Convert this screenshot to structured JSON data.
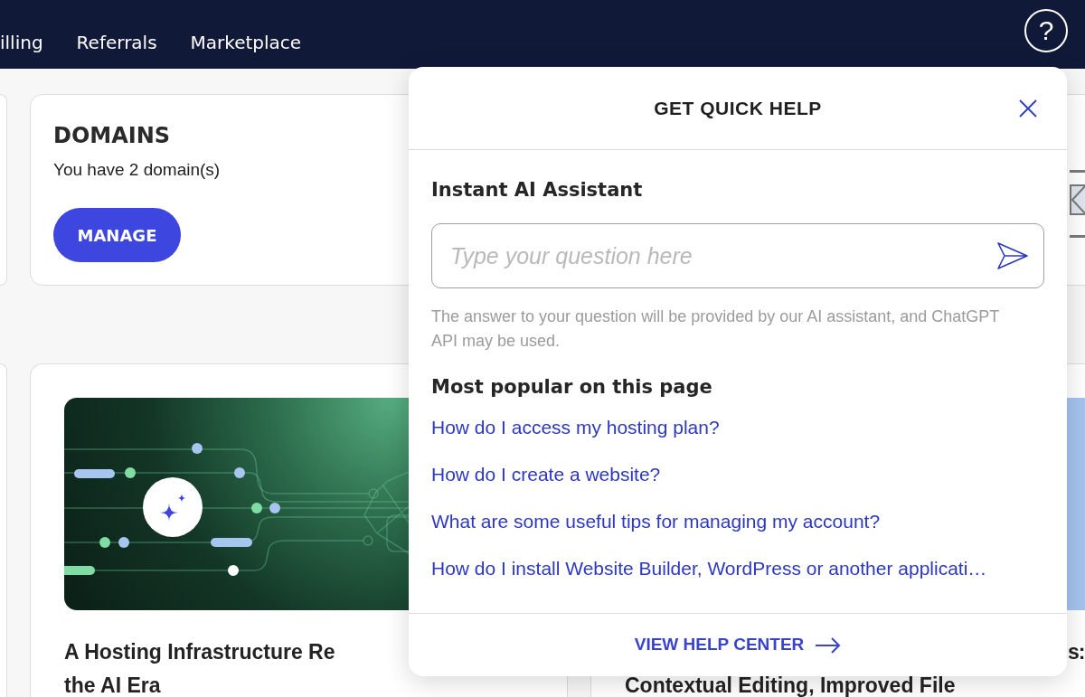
{
  "top_nav": {
    "items": [
      "illing",
      "Referrals",
      "Marketplace"
    ],
    "help_button": "?"
  },
  "domains_card": {
    "title": "DOMAINS",
    "text": "You have 2 domain(s)",
    "button": "MANAGE"
  },
  "articles": [
    {
      "title_lines": [
        "A Hosting Infrastructure Re",
        "the AI Era"
      ]
    },
    {
      "title_lines": [
        "s:",
        "Contextual Editing, Improved File"
      ]
    }
  ],
  "quick_help": {
    "title": "GET QUICK HELP",
    "assistant_heading": "Instant AI Assistant",
    "question_field": {
      "placeholder": "Type your question here"
    },
    "disclaimer": "The answer to your question will be provided by our AI assistant, and ChatGPT API may be used.",
    "popular_heading": "Most popular on this page",
    "popular_links": [
      "How do I access my hosting plan?",
      "How do I create a website?",
      "What are some useful tips for managing my account?",
      "How do I install Website Builder, WordPress or another applicati…"
    ],
    "footer_link": "VIEW HELP CENTER"
  }
}
